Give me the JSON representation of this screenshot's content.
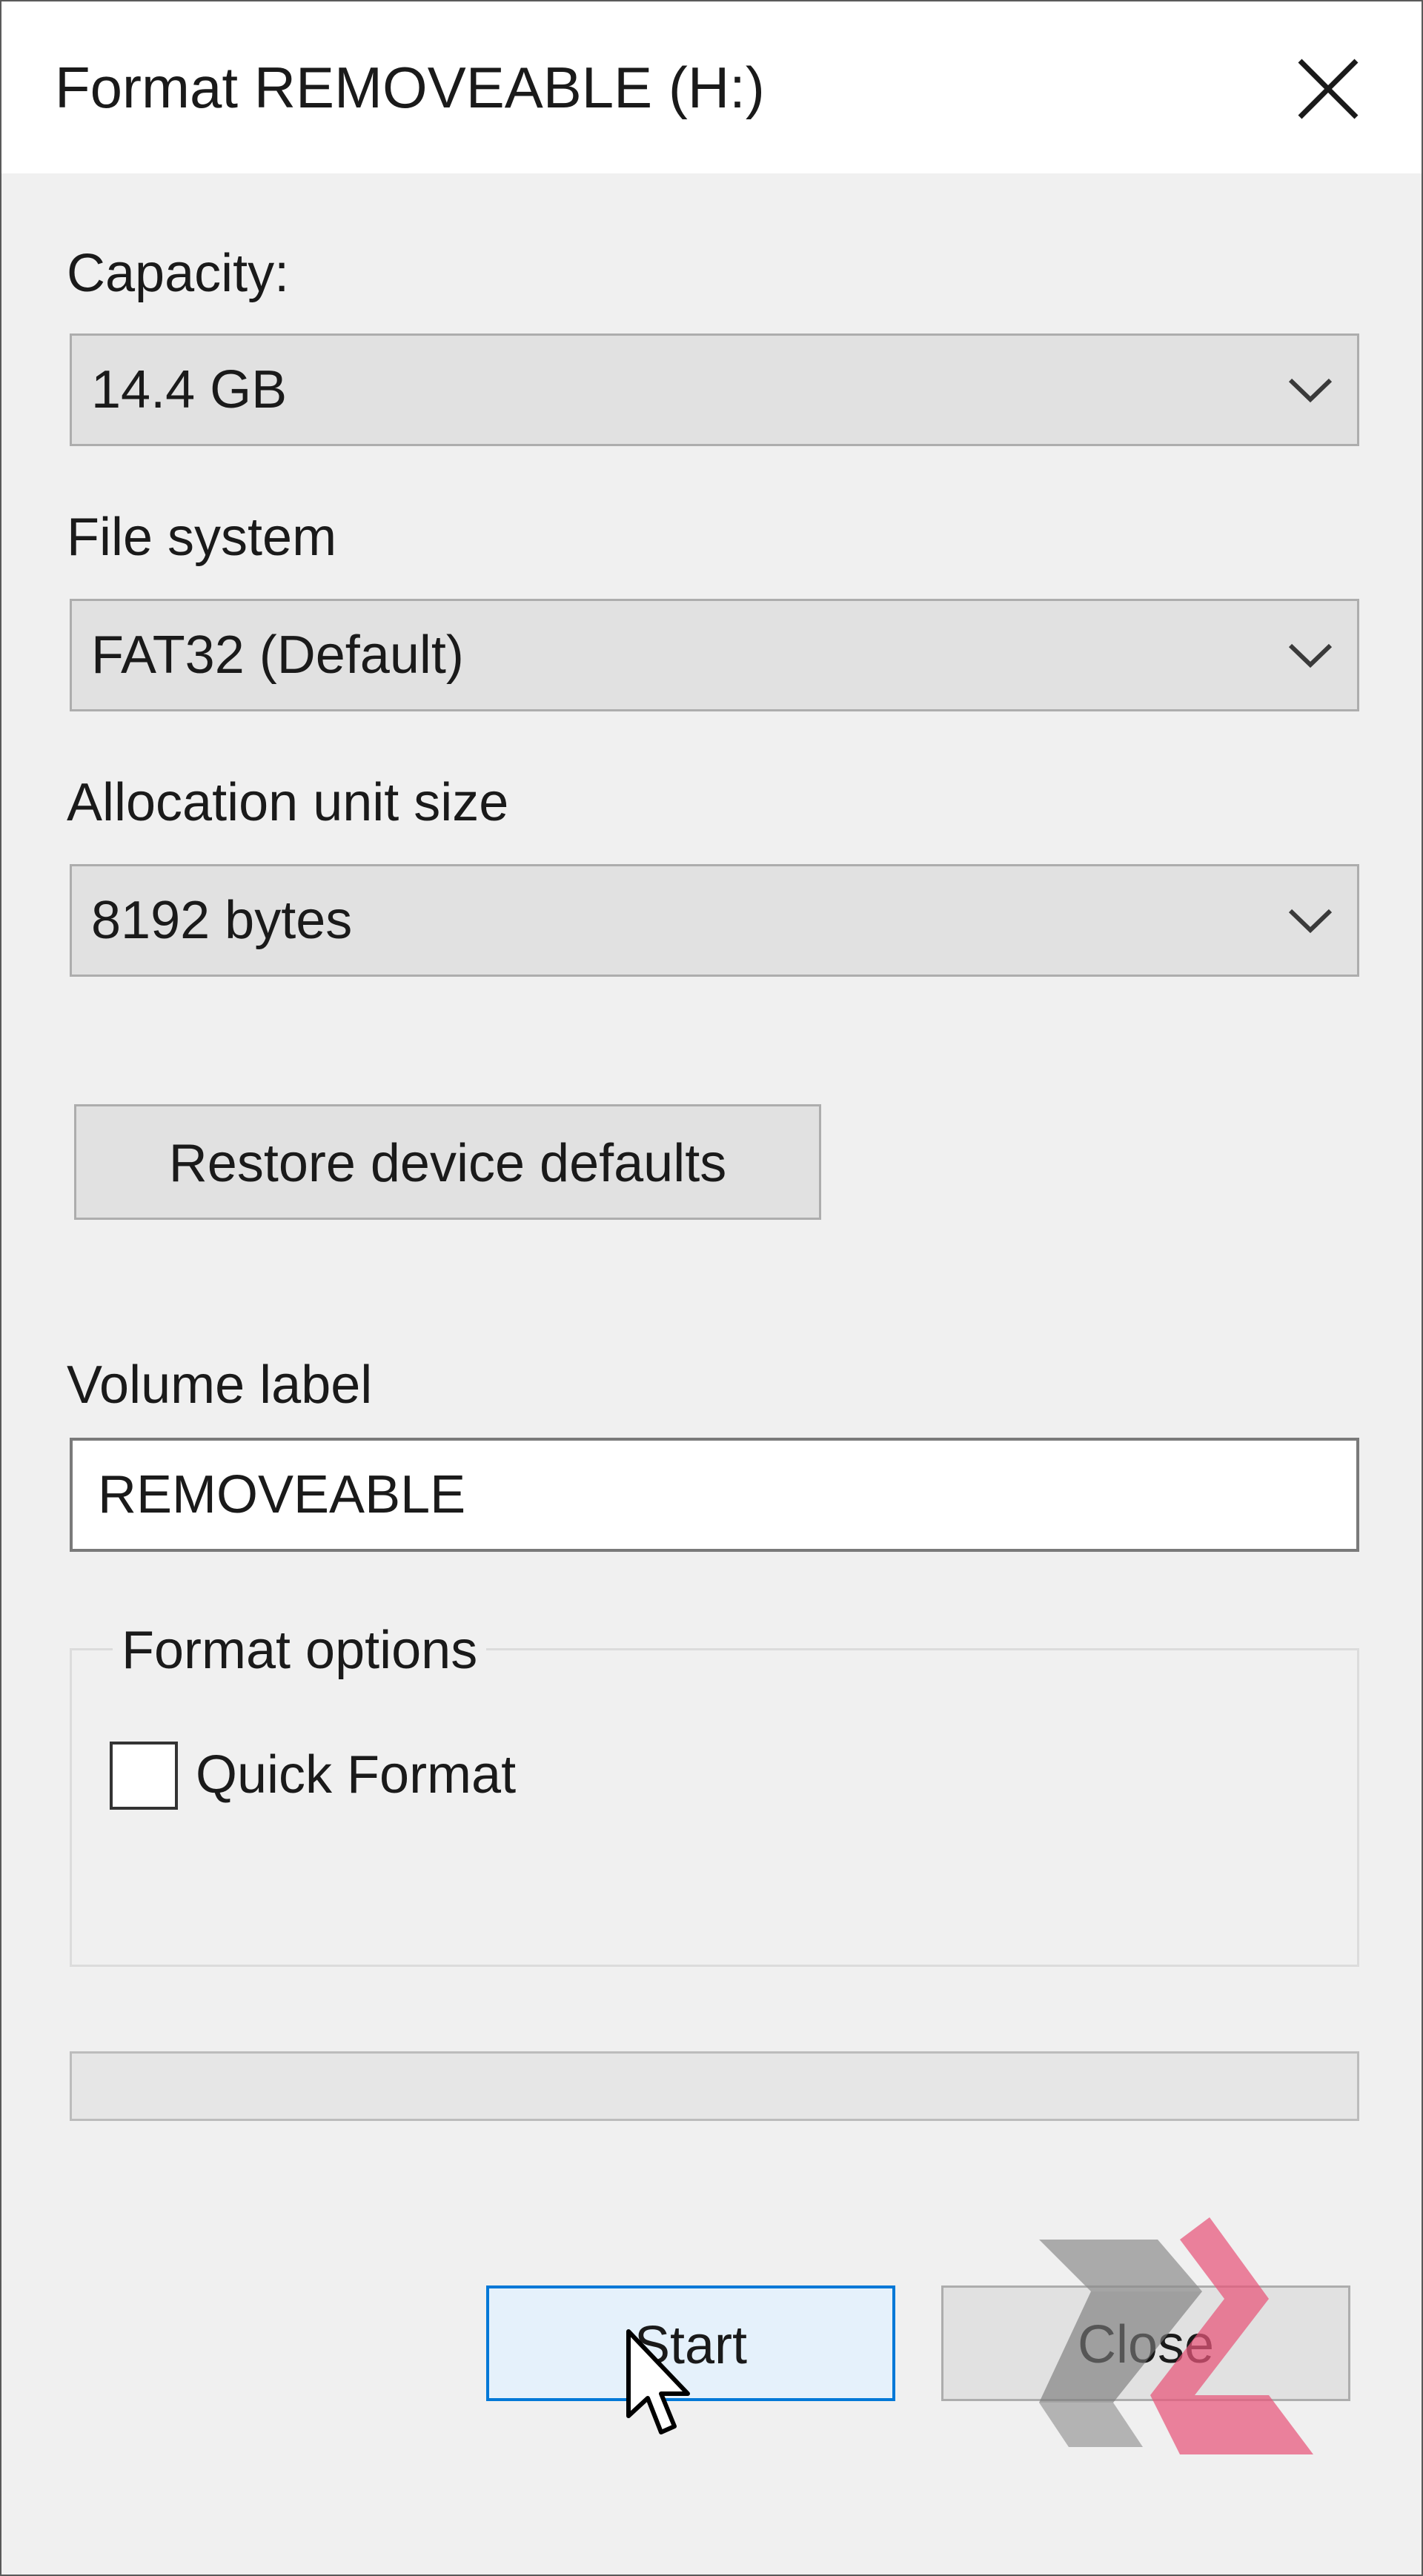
{
  "window": {
    "title": "Format REMOVEABLE (H:)"
  },
  "capacity": {
    "label": "Capacity:",
    "value": "14.4 GB"
  },
  "file_system": {
    "label": "File system",
    "value": "FAT32 (Default)"
  },
  "allocation": {
    "label": "Allocation unit size",
    "value": "8192 bytes"
  },
  "restore_button": {
    "label": "Restore device defaults"
  },
  "volume_label": {
    "label": "Volume label",
    "value": "REMOVEABLE"
  },
  "format_options": {
    "legend": "Format options",
    "quick_format_label": "Quick Format",
    "quick_format_checked": false
  },
  "progress": {
    "fraction": 0
  },
  "buttons": {
    "start_label": "Start",
    "close_label": "Close"
  },
  "icons": {
    "close": "close-icon",
    "dropdown": "chevron-down-icon",
    "cursor": "mouse-pointer-icon",
    "watermark": "logo-watermark"
  },
  "colors": {
    "accent": "#0078d7",
    "start_bg": "#e5f1fb",
    "watermark_pink": "#e8567a",
    "watermark_gray": "#7a7a7a"
  }
}
